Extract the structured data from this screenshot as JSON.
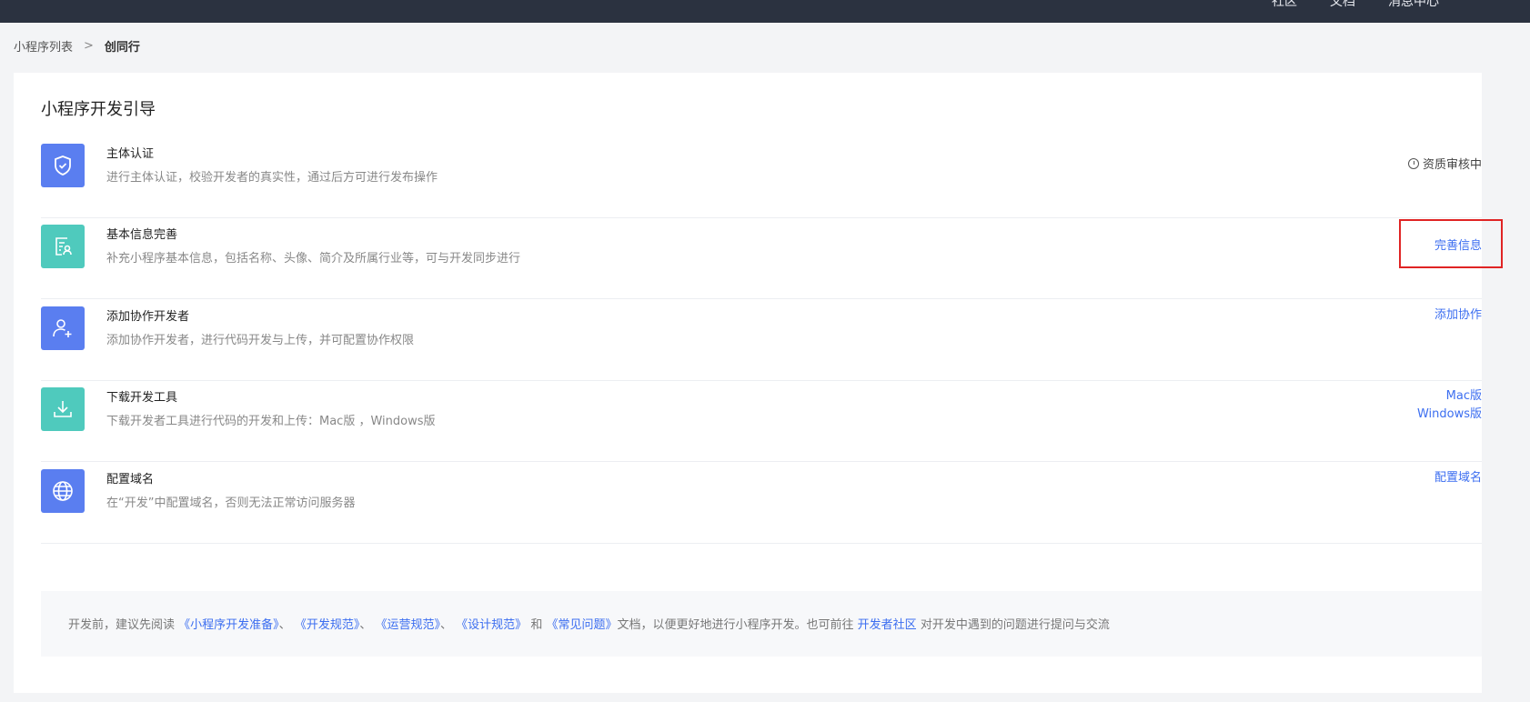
{
  "topbar": {
    "nav": [
      "社区",
      "文档",
      "消息中心"
    ]
  },
  "breadcrumb": {
    "parent": "小程序列表",
    "separator": ">",
    "current": "创同行"
  },
  "card": {
    "title": "小程序开发引导"
  },
  "rows": [
    {
      "icon": "shield-check-icon",
      "title": "主体认证",
      "desc": "进行主体认证，校验开发者的真实性，通过后方可进行发布操作",
      "status": "资质审核中",
      "status_icon": "clock-icon"
    },
    {
      "icon": "profile-document-icon",
      "title": "基本信息完善",
      "desc": "补充小程序基本信息，包括名称、头像、简介及所属行业等，可与开发同步进行",
      "action": "完善信息"
    },
    {
      "icon": "user-add-icon",
      "title": "添加协作开发者",
      "desc": "添加协作开发者，进行代码开发与上传，并可配置协作权限",
      "action": "添加协作"
    },
    {
      "icon": "download-icon",
      "title": "下载开发工具",
      "desc": "下载开发者工具进行代码的开发和上传：Mac版 ，Windows版",
      "action_mac": "Mac版",
      "action_win": "Windows版"
    },
    {
      "icon": "globe-icon",
      "title": "配置域名",
      "desc": "在“开发”中配置域名，否则无法正常访问服务器",
      "action": "配置域名"
    }
  ],
  "notice": {
    "prefix": "开发前，建议先阅读",
    "link1": "《小程序开发准备》",
    "sep1": "、",
    "link2": "《开发规范》",
    "sep2": "、",
    "link3": "《运营规范》",
    "sep3": "、",
    "link4": "《设计规范》",
    "and": "和",
    "link5": "《常见问题》",
    "mid": "文档，以便更好地进行小程序开发。也可前往",
    "link6": "开发者社区",
    "suffix": "对开发中遇到的问题进行提问与交流"
  },
  "colors": {
    "primary": "#3c6ef0",
    "icon_blue": "#5a7ef0",
    "icon_teal": "#4fcabd",
    "highlight": "#e02424",
    "topbar": "#2b3240"
  }
}
